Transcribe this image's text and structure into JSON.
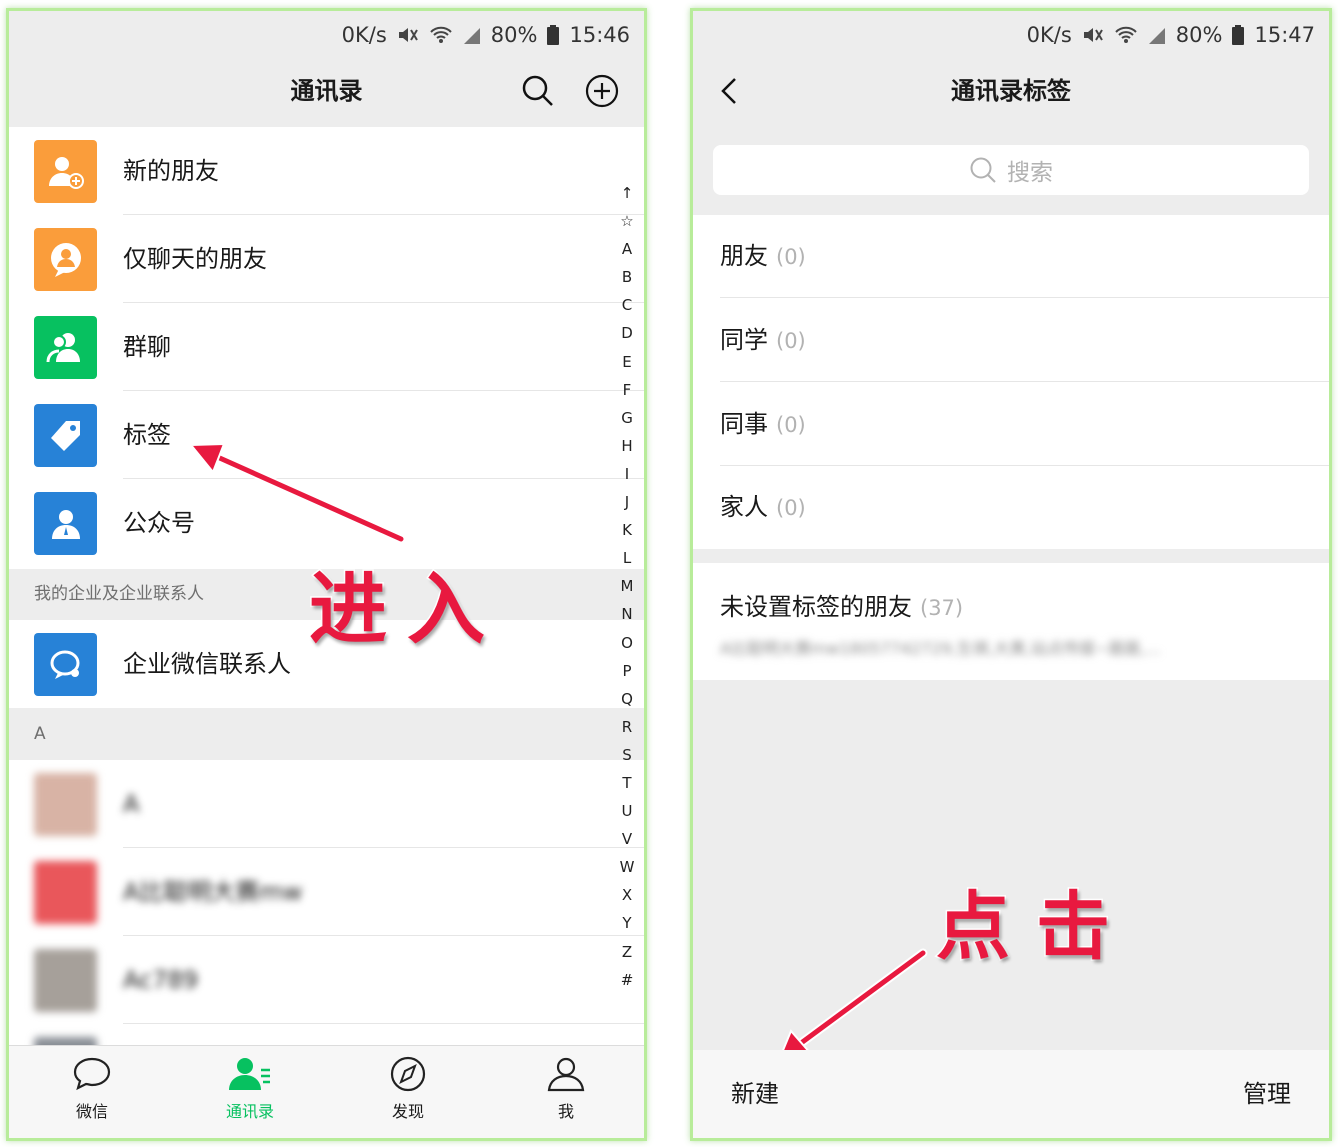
{
  "left": {
    "status": {
      "speed": "0K/s",
      "battery": "80%",
      "time": "15:46"
    },
    "title": "通讯录",
    "rows": [
      {
        "label": "新的朋友",
        "color": "#fa9d3b",
        "icon": "add-friend-icon"
      },
      {
        "label": "仅聊天的朋友",
        "color": "#fa9d3b",
        "icon": "chat-only-friend-icon"
      },
      {
        "label": "群聊",
        "color": "#07c160",
        "icon": "group-chat-icon"
      },
      {
        "label": "标签",
        "color": "#2782d7",
        "icon": "tag-icon"
      },
      {
        "label": "公众号",
        "color": "#2782d7",
        "icon": "official-account-icon"
      }
    ],
    "section_enterprise": "我的企业及企业联系人",
    "enterprise_row": {
      "label": "企业微信联系人",
      "color": "#2782d7",
      "icon": "enterprise-wechat-icon"
    },
    "section_a": "A",
    "contacts": [
      {
        "name": "A",
        "avatar_color": "#d8b3a5"
      },
      {
        "name": "A比聪明大赛mw",
        "avatar_color": "#e9575b"
      },
      {
        "name": "Ac789",
        "avatar_color": "#a6a09a"
      }
    ],
    "index_letters": [
      "↑",
      "☆",
      "A",
      "B",
      "C",
      "D",
      "E",
      "F",
      "G",
      "H",
      "I",
      "J",
      "K",
      "L",
      "M",
      "N",
      "O",
      "P",
      "Q",
      "R",
      "S",
      "T",
      "U",
      "V",
      "W",
      "X",
      "Y",
      "Z",
      "#"
    ],
    "tabs": [
      {
        "label": "微信",
        "icon": "chat-bubble-icon",
        "active": false
      },
      {
        "label": "通讯录",
        "icon": "contacts-icon",
        "active": true
      },
      {
        "label": "发现",
        "icon": "compass-icon",
        "active": false
      },
      {
        "label": "我",
        "icon": "person-icon",
        "active": false
      }
    ],
    "annotation": "进入"
  },
  "right": {
    "status": {
      "speed": "0K/s",
      "battery": "80%",
      "time": "15:47"
    },
    "title": "通讯录标签",
    "search_placeholder": "搜索",
    "tags": [
      {
        "name": "朋友",
        "count": "(0)"
      },
      {
        "name": "同学",
        "count": "(0)"
      },
      {
        "name": "同事",
        "count": "(0)"
      },
      {
        "name": "家人",
        "count": "(0)"
      }
    ],
    "untagged": {
      "name": "未设置标签的朋友",
      "count": "(37)",
      "members": "A比聪明大赛mw18057742729,生祺,大黄,站点传媒~聂聂,..."
    },
    "new_label": "新建",
    "manage_label": "管理",
    "annotation": "点击"
  },
  "colors": {
    "accent": "#07c160",
    "annotation": "#e8193f",
    "frame": "#b8ec9a"
  }
}
